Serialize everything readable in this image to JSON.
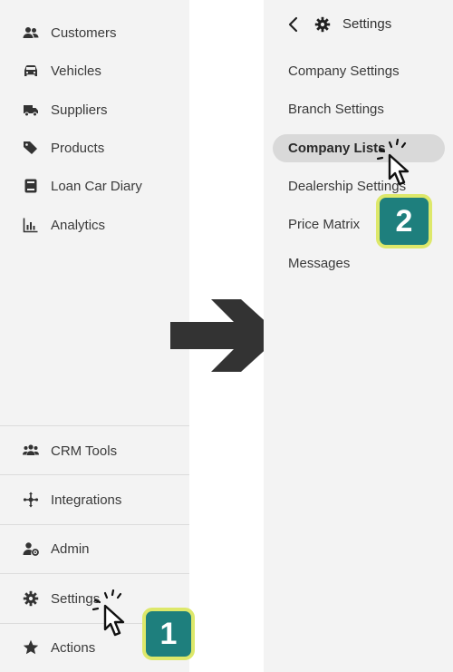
{
  "left_menu": {
    "items": [
      {
        "label": "Customers",
        "icon": "customers-icon"
      },
      {
        "label": "Vehicles",
        "icon": "car-icon"
      },
      {
        "label": "Suppliers",
        "icon": "truck-icon"
      },
      {
        "label": "Products",
        "icon": "tag-icon"
      },
      {
        "label": "Loan Car Diary",
        "icon": "diary-icon"
      },
      {
        "label": "Analytics",
        "icon": "chart-icon"
      }
    ],
    "bottom_items": [
      {
        "label": "CRM Tools",
        "icon": "group-icon"
      },
      {
        "label": "Integrations",
        "icon": "integrations-icon"
      },
      {
        "label": "Admin",
        "icon": "admin-icon"
      },
      {
        "label": "Settings",
        "icon": "gear-icon"
      },
      {
        "label": "Actions",
        "icon": "star-icon"
      }
    ]
  },
  "settings_panel": {
    "title": "Settings",
    "items": [
      {
        "label": "Company Settings"
      },
      {
        "label": "Branch Settings"
      },
      {
        "label": "Company Lists"
      },
      {
        "label": "Dealership Settings"
      },
      {
        "label": "Price Matrix"
      },
      {
        "label": "Messages"
      }
    ],
    "active_item": "Company Lists"
  },
  "steps": {
    "step1": "1",
    "step2": "2"
  },
  "colors": {
    "badge_bg": "#1e7f7d",
    "badge_border": "#dde86a",
    "panel_bg": "#f3f3f3",
    "highlight": "#d9d9d9"
  }
}
